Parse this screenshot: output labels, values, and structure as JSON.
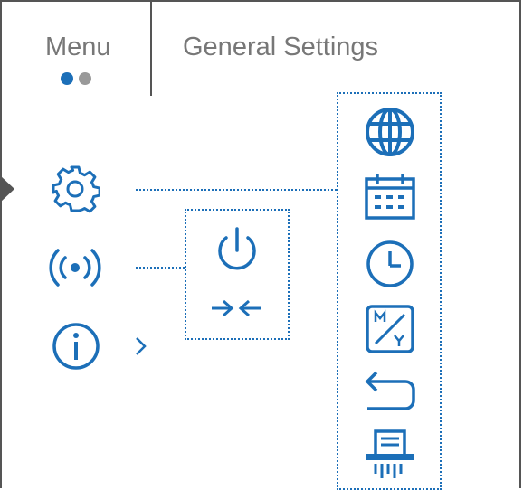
{
  "header": {
    "menu_label": "Menu",
    "general_settings_label": "General Settings",
    "page_indicator": {
      "active_index": 0,
      "count": 2
    }
  },
  "colors": {
    "accent": "#1c6fb8",
    "text_gray": "#777777",
    "border": "#555555",
    "dot_inactive": "#999999"
  },
  "left_menu": {
    "items": [
      {
        "icon": "gear-icon"
      },
      {
        "icon": "wireless-signal-icon"
      },
      {
        "icon": "info-icon"
      }
    ]
  },
  "middle_submenu": {
    "items": [
      {
        "icon": "power-icon"
      },
      {
        "icon": "compress-arrows-icon"
      }
    ]
  },
  "right_submenu": {
    "items": [
      {
        "icon": "globe-icon"
      },
      {
        "icon": "calendar-icon"
      },
      {
        "icon": "clock-icon"
      },
      {
        "icon": "units-m-y-icon"
      },
      {
        "icon": "return-arrow-icon"
      },
      {
        "icon": "shredder-icon"
      }
    ]
  }
}
